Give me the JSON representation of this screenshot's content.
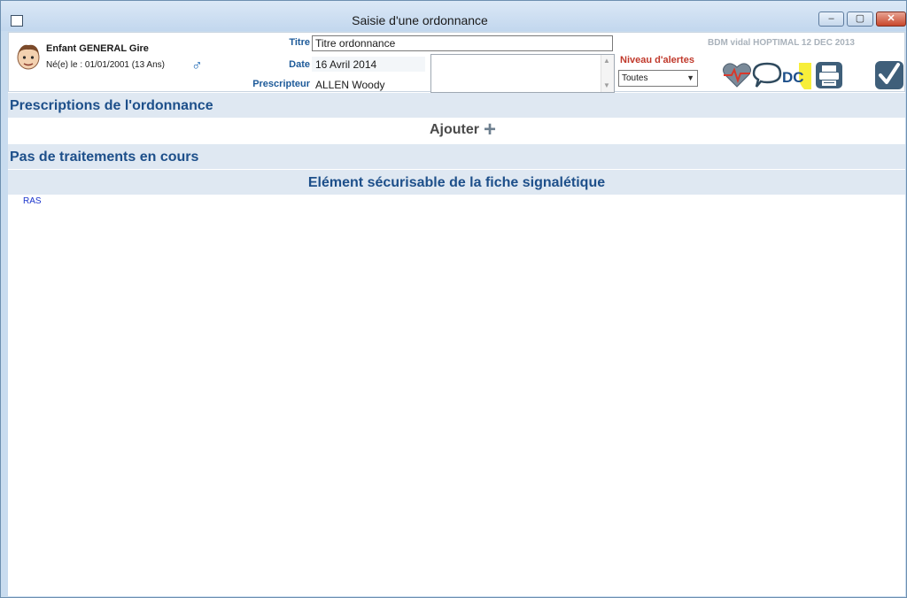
{
  "window": {
    "title": "Saisie d'une ordonnance",
    "controls": {
      "minimize": "–",
      "maximize": "▢",
      "close": "✕"
    }
  },
  "patient": {
    "name": "Enfant GENERAL Gire",
    "dob": "Né(e) le : 01/01/2001 (13 Ans)",
    "gender_symbol": "♂",
    "avatar_icon": "child-avatar-icon"
  },
  "prescription": {
    "title_label": "Titre",
    "title_value": "Titre ordonnance",
    "date_label": "Date",
    "date_value": "16 Avril 2014",
    "prescriber_label": "Prescripteur",
    "prescriber_value": "ALLEN Woody",
    "notes_value": ""
  },
  "alerts": {
    "label": "Niveau d'alertes",
    "selected": "Toutes"
  },
  "database": "BDM vidal HOPTIMAL 12 DEC 2013",
  "toolbar": {
    "icons": [
      "heartbeat-icon",
      "speech-bubble-icon",
      "dc-icon",
      "print-icon",
      "validate-check-icon"
    ],
    "dc_label": "DC"
  },
  "sections": {
    "prescriptions_title": "Prescriptions de l'ordonnance",
    "add_label": "Ajouter",
    "add_icon": "+",
    "treatments_title": "Pas de traitements en cours",
    "secure_title": "Elément sécurisable de la fiche signalétique",
    "secure_value": "RAS"
  },
  "colors": {
    "section_bg": "#dfe8f2",
    "section_text": "#1d4f8a",
    "alert_label": "#c0392b",
    "accent_blue": "#1a66b3"
  }
}
